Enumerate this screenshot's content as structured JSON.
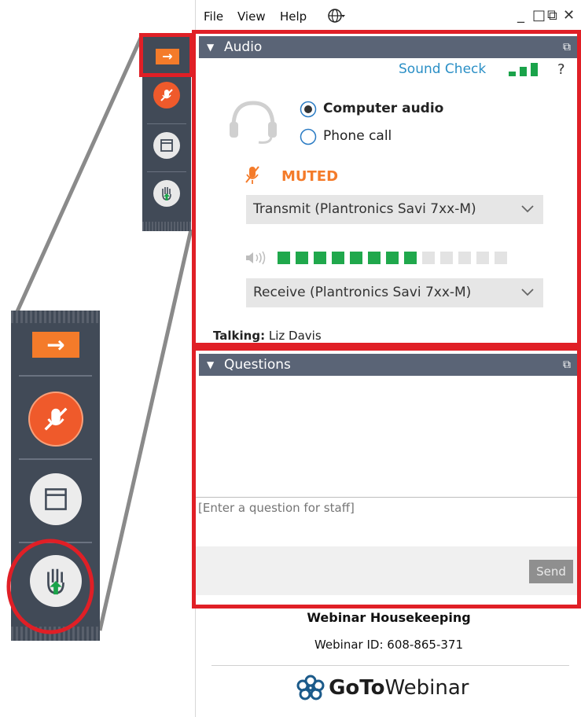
{
  "menubar": {
    "file": "File",
    "view": "View",
    "help": "Help",
    "globe_icon": "globe-icon",
    "caret": "▾",
    "minimize": "_",
    "restore": "□",
    "popout": "⧉",
    "close": "✕"
  },
  "audio": {
    "title": "Audio",
    "sound_check": "Sound Check",
    "help": "?",
    "options": [
      {
        "label": "Computer audio",
        "selected": true
      },
      {
        "label": "Phone call",
        "selected": false
      }
    ],
    "mute_status": "MUTED",
    "transmit_device": "Transmit (Plantronics Savi 7xx-M)",
    "receive_device": "Receive (Plantronics Savi 7xx-M)",
    "speaker_level": {
      "active": 8,
      "total": 13
    },
    "talking_label": "Talking:",
    "talking_name": "Liz Davis"
  },
  "questions": {
    "title": "Questions",
    "input_placeholder": "[Enter a question for staff]",
    "send_label": "Send"
  },
  "footer": {
    "webinar_name": "Webinar Housekeeping",
    "webinar_id": "Webinar ID: 608-865-371",
    "brand_bold": "GoTo",
    "brand_light": "Webinar"
  },
  "colors": {
    "accent_orange": "#f47b2a",
    "highlight_red": "#e01f26",
    "meter_green": "#20a84c",
    "link_blue": "#2a8fc6"
  }
}
